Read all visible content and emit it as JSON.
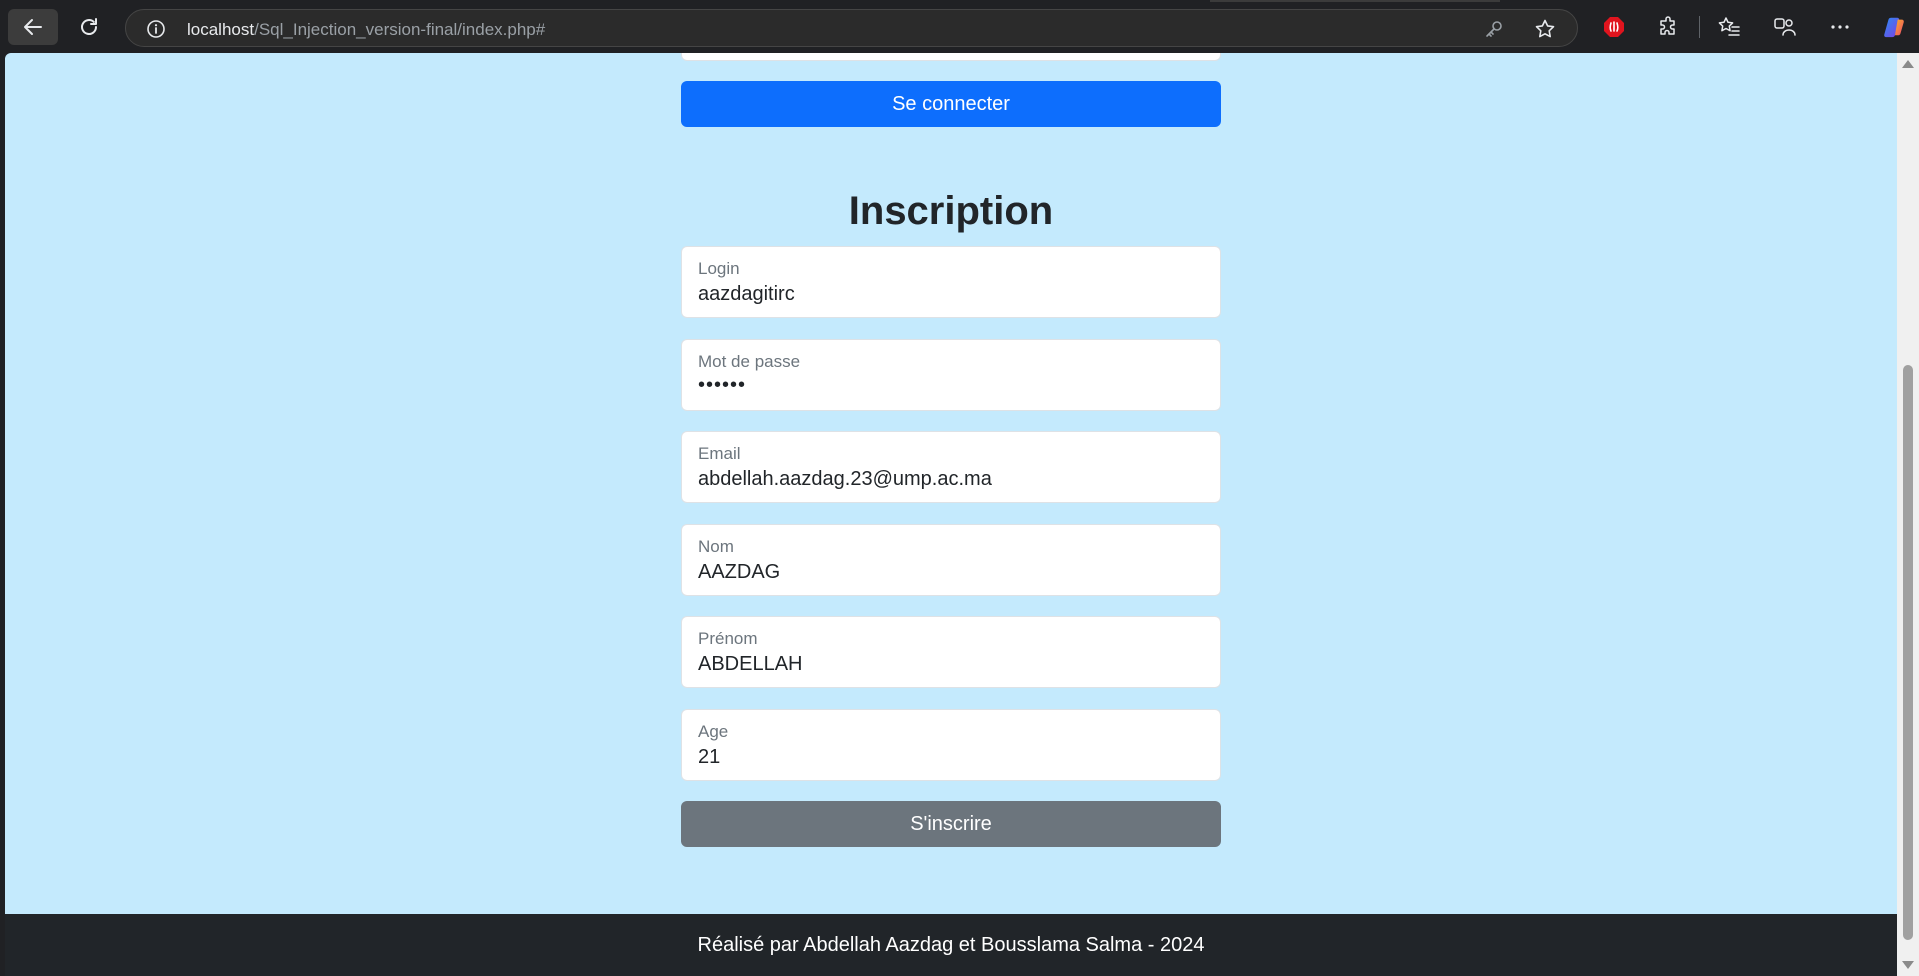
{
  "browser": {
    "url_host": "localhost",
    "url_path": "/Sql_Injection_version-final/index.php#",
    "icons": [
      "back-arrow-icon",
      "reload-icon",
      "info-icon",
      "key-icon",
      "favorite-star-icon",
      "adblock-icon",
      "extensions-icon",
      "favorites-icon",
      "profile-sync-icon",
      "more-icon",
      "copilot-icon"
    ],
    "accent_colors": {
      "adblock": "#e0141e"
    }
  },
  "login": {
    "submit_label": "Se connecter"
  },
  "register": {
    "title": "Inscription",
    "fields": [
      {
        "label": "Login",
        "value": "aazdagitirc"
      },
      {
        "label": "Mot de passe",
        "value": "••••••"
      },
      {
        "label": "Email",
        "value": "abdellah.aazdag.23@ump.ac.ma"
      },
      {
        "label": "Nom",
        "value": "AAZDAG"
      },
      {
        "label": "Prénom",
        "value": "ABDELLAH"
      },
      {
        "label": "Age",
        "value": "21"
      }
    ],
    "submit_label": "S'inscrire"
  },
  "footer": {
    "text": "Réalisé par Abdellah Aazdag et Bousslama Salma - 2024"
  },
  "colors": {
    "page_background": "#c4eafd",
    "primary_button": "#0d6efd",
    "secondary_button": "#6c757d",
    "footer_background": "#212529"
  }
}
